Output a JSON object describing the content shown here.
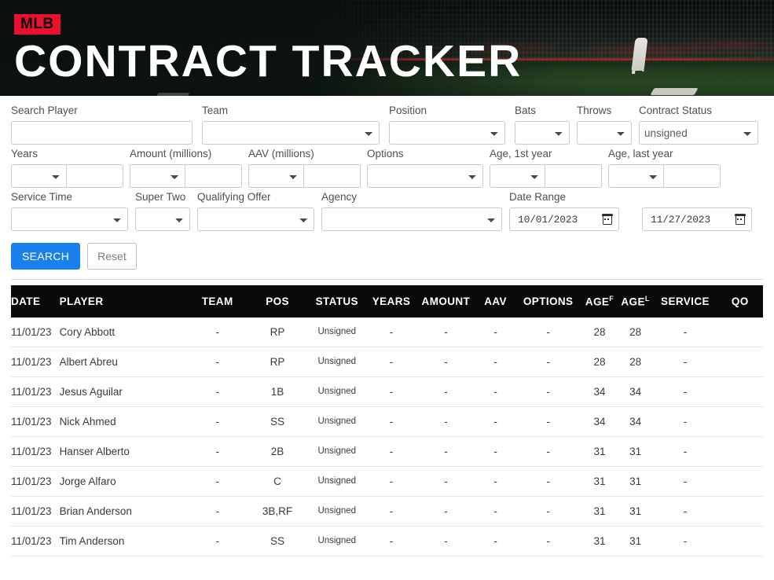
{
  "banner": {
    "logo_text": "MLB",
    "title": "CONTRACT TRACKER",
    "logo_bg": "#e8122e",
    "background": "#0b1412"
  },
  "filters": {
    "row1": [
      {
        "label": "Search Player",
        "type": "text",
        "value": "",
        "name": "search-player-input"
      },
      {
        "label": "Team",
        "type": "select",
        "value": "",
        "name": "team-select"
      },
      {
        "label": "Position",
        "type": "select",
        "value": "",
        "name": "position-select"
      },
      {
        "label": "Bats",
        "type": "select",
        "value": "",
        "name": "bats-select"
      },
      {
        "label": "Throws",
        "type": "select",
        "value": "",
        "name": "throws-select"
      },
      {
        "label": "Contract Status",
        "type": "select",
        "value": "unsigned",
        "name": "contract-status-select"
      }
    ],
    "row2": [
      {
        "label": "Years",
        "type": "pair",
        "select_value": "",
        "input_value": ""
      },
      {
        "label": "Amount (millions)",
        "type": "pair",
        "select_value": "",
        "input_value": ""
      },
      {
        "label": "AAV (millions)",
        "type": "pair",
        "select_value": "",
        "input_value": ""
      },
      {
        "label": "Options",
        "type": "select",
        "value": ""
      },
      {
        "label": "Age, 1st year",
        "type": "pair",
        "select_value": "",
        "input_value": ""
      },
      {
        "label": "Age, last year",
        "type": "pair",
        "select_value": "",
        "input_value": ""
      }
    ],
    "row3": [
      {
        "label": "Service Time",
        "type": "select",
        "value": ""
      },
      {
        "label": "Super Two",
        "type": "select",
        "value": ""
      },
      {
        "label": "Qualifying Offer",
        "type": "select",
        "value": ""
      },
      {
        "label": "Agency",
        "type": "select",
        "value": ""
      }
    ],
    "date_range": {
      "label": "Date Range",
      "start": "10/01/2023",
      "end": "11/27/2023",
      "icon": "calendar-icon"
    },
    "buttons": {
      "search_label": "SEARCH",
      "reset_label": "Reset",
      "search_color": "#1a80ed"
    }
  },
  "table": {
    "columns": [
      {
        "key": "date",
        "label": "DATE",
        "align": "left"
      },
      {
        "key": "player",
        "label": "PLAYER",
        "align": "left"
      },
      {
        "key": "team",
        "label": "TEAM",
        "align": "center"
      },
      {
        "key": "pos",
        "label": "POS",
        "align": "center"
      },
      {
        "key": "status",
        "label": "STATUS",
        "align": "center"
      },
      {
        "key": "years",
        "label": "YEARS",
        "align": "center"
      },
      {
        "key": "amount",
        "label": "AMOUNT",
        "align": "center"
      },
      {
        "key": "aav",
        "label": "AAV",
        "align": "center"
      },
      {
        "key": "options",
        "label": "OPTIONS",
        "align": "center"
      },
      {
        "key": "age_first",
        "label": "AGE",
        "sup": "F",
        "align": "center"
      },
      {
        "key": "age_last",
        "label": "AGE",
        "sup": "L",
        "align": "center"
      },
      {
        "key": "service",
        "label": "SERVICE",
        "align": "center"
      },
      {
        "key": "qo",
        "label": "QO",
        "align": "center"
      }
    ],
    "rows": [
      {
        "date": "11/01/23",
        "player": "Cory Abbott",
        "team": "-",
        "pos": "RP",
        "status": "Unsigned",
        "years": "-",
        "amount": "-",
        "aav": "-",
        "options": "-",
        "age_first": "28",
        "age_last": "28",
        "service": "-",
        "qo": ""
      },
      {
        "date": "11/01/23",
        "player": "Albert Abreu",
        "team": "-",
        "pos": "RP",
        "status": "Unsigned",
        "years": "-",
        "amount": "-",
        "aav": "-",
        "options": "-",
        "age_first": "28",
        "age_last": "28",
        "service": "-",
        "qo": ""
      },
      {
        "date": "11/01/23",
        "player": "Jesus Aguilar",
        "team": "-",
        "pos": "1B",
        "status": "Unsigned",
        "years": "-",
        "amount": "-",
        "aav": "-",
        "options": "-",
        "age_first": "34",
        "age_last": "34",
        "service": "-",
        "qo": ""
      },
      {
        "date": "11/01/23",
        "player": "Nick Ahmed",
        "team": "-",
        "pos": "SS",
        "status": "Unsigned",
        "years": "-",
        "amount": "-",
        "aav": "-",
        "options": "-",
        "age_first": "34",
        "age_last": "34",
        "service": "-",
        "qo": ""
      },
      {
        "date": "11/01/23",
        "player": "Hanser Alberto",
        "team": "-",
        "pos": "2B",
        "status": "Unsigned",
        "years": "-",
        "amount": "-",
        "aav": "-",
        "options": "-",
        "age_first": "31",
        "age_last": "31",
        "service": "-",
        "qo": ""
      },
      {
        "date": "11/01/23",
        "player": "Jorge Alfaro",
        "team": "-",
        "pos": "C",
        "status": "Unsigned",
        "years": "-",
        "amount": "-",
        "aav": "-",
        "options": "-",
        "age_first": "31",
        "age_last": "31",
        "service": "-",
        "qo": ""
      },
      {
        "date": "11/01/23",
        "player": "Brian Anderson",
        "team": "-",
        "pos": "3B,RF",
        "status": "Unsigned",
        "years": "-",
        "amount": "-",
        "aav": "-",
        "options": "-",
        "age_first": "31",
        "age_last": "31",
        "service": "-",
        "qo": ""
      },
      {
        "date": "11/01/23",
        "player": "Tim Anderson",
        "team": "-",
        "pos": "SS",
        "status": "Unsigned",
        "years": "-",
        "amount": "-",
        "aav": "-",
        "options": "-",
        "age_first": "31",
        "age_last": "31",
        "service": "-",
        "qo": ""
      }
    ]
  }
}
